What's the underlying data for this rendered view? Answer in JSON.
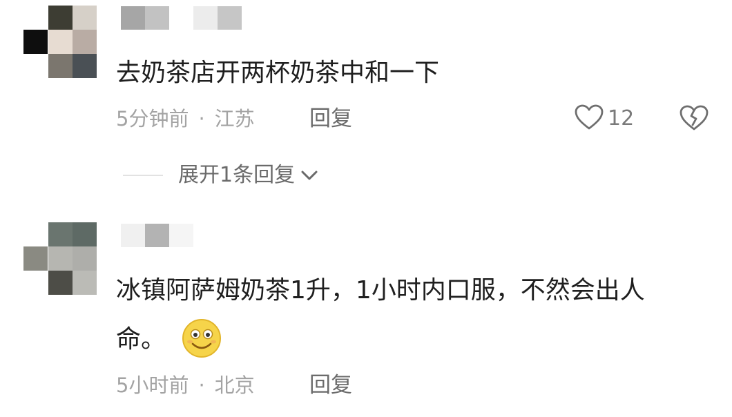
{
  "comments": [
    {
      "text": "去奶茶店开两杯奶茶中和一下",
      "time": "5分钟前",
      "separator": "·",
      "location": "江苏",
      "reply_label": "回复",
      "like_count": "12",
      "expand_replies_label": "展开1条回复"
    },
    {
      "text_line1": "冰镇阿萨姆奶茶1升，1小时内口服，不然会出人",
      "text_line2": "命。",
      "emoji": "smiley-face-emoji",
      "time": "5小时前",
      "separator": "·",
      "location": "北京",
      "reply_label": "回复"
    }
  ],
  "icons": {
    "like": "heart-outline-icon",
    "dislike": "broken-heart-icon",
    "expand": "chevron-down-icon"
  },
  "colors": {
    "text": "#1f1f1f",
    "meta": "#a3a3a3",
    "reply": "#6b6b6b"
  }
}
